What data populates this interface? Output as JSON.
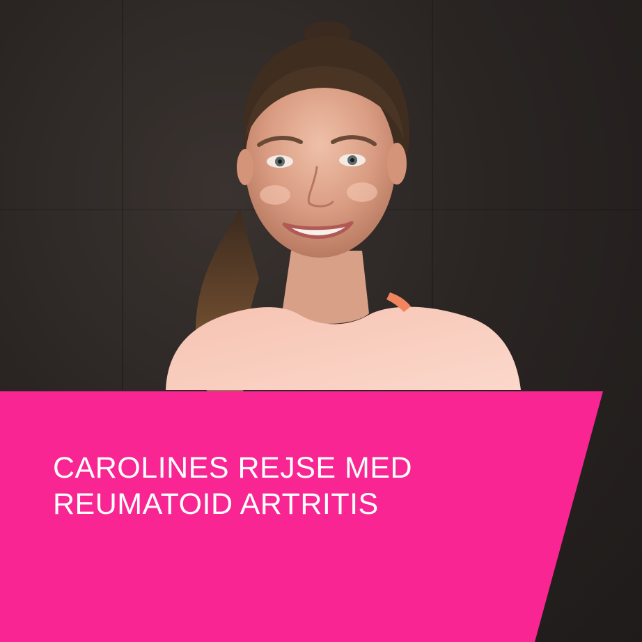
{
  "headline": {
    "line1": "CAROLINES REJSE MED",
    "line2": "REUMATOID ARTRITIS"
  },
  "colors": {
    "banner": "#f82593",
    "background": "#252120",
    "text": "#ffffff",
    "shirt": "#f9cbbc"
  }
}
